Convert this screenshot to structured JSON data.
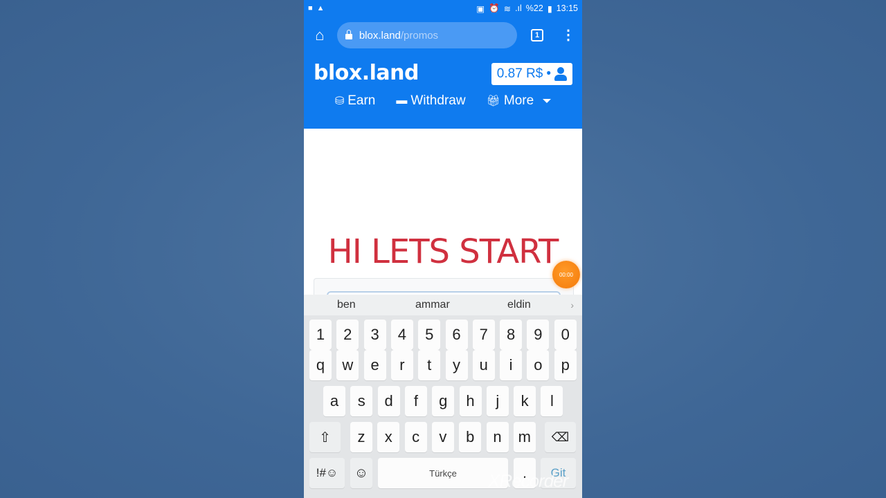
{
  "statusbar": {
    "left_icons": [
      "video-icon",
      "warning-icon"
    ],
    "right_icons": [
      "cast-icon",
      "alarm-icon",
      "wifi-icon",
      "signal-icon"
    ],
    "battery": "%22",
    "time": "13:15"
  },
  "browser": {
    "url_domain": "blox.land",
    "url_path": "/promos",
    "tab_count": "1"
  },
  "site": {
    "brand": "blox.land",
    "balance": "0.87 R$",
    "balance_separator": "•",
    "nav": [
      {
        "label": "Earn",
        "icon": "coins-icon"
      },
      {
        "label": "Withdraw",
        "icon": "credit-card-icon"
      },
      {
        "label": "More",
        "icon": "gift-icon"
      }
    ],
    "headline": "HI LETS START"
  },
  "recorder": {
    "timer": "00:00",
    "watermark": "XRecorder"
  },
  "keyboard": {
    "suggestions": [
      "ben",
      "ammar",
      "eldin"
    ],
    "row_numbers": [
      "1",
      "2",
      "3",
      "4",
      "5",
      "6",
      "7",
      "8",
      "9",
      "0"
    ],
    "row_1": [
      "q",
      "w",
      "e",
      "r",
      "t",
      "y",
      "u",
      "i",
      "o",
      "p"
    ],
    "row_2": [
      "a",
      "s",
      "d",
      "f",
      "g",
      "h",
      "j",
      "k",
      "l"
    ],
    "row_3": [
      "z",
      "x",
      "c",
      "v",
      "b",
      "n",
      "m"
    ],
    "symbols_label": "!#☺",
    "space_label": "Türkçe",
    "period_label": ".",
    "go_label": "Git",
    "go_color": "#5aa0c8"
  },
  "colors": {
    "brand_blue": "#0f7bef",
    "headline_red": "#d0303f",
    "record_orange": "#f47a0a"
  }
}
